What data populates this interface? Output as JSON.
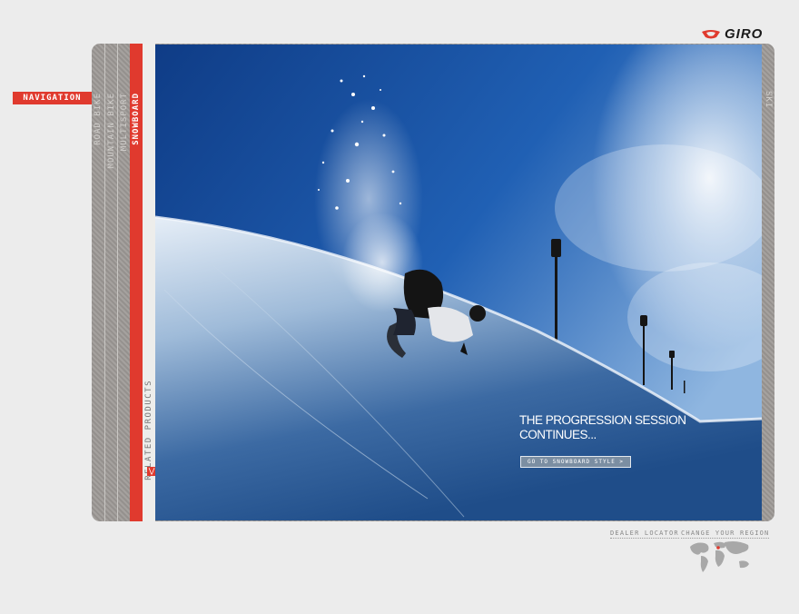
{
  "brand": {
    "name": "GIRO",
    "accent_color": "#e03a2e"
  },
  "navigation": {
    "tab_label": "NAVIGATION",
    "sports": [
      {
        "label": "ROAD BIKE",
        "active": false
      },
      {
        "label": "MOUNTAIN BIKE",
        "active": false
      },
      {
        "label": "MULTISPORT",
        "active": false
      },
      {
        "label": "SNOWBOARD",
        "active": true
      }
    ],
    "right_sport": {
      "label": "SKI"
    }
  },
  "related": {
    "label": "RELATED PRODUCTS",
    "icon": "chevron-icon"
  },
  "hero": {
    "headline_line1": "THE PROGRESSION SESSION",
    "headline_line2": "CONTINUES...",
    "cta_label": "GO TO SNOWBOARD STYLE >"
  },
  "footer": {
    "dealer_locator": "DEALER LOCATOR",
    "change_region": "CHANGE YOUR REGION",
    "map_icon": "world-map-icon"
  }
}
